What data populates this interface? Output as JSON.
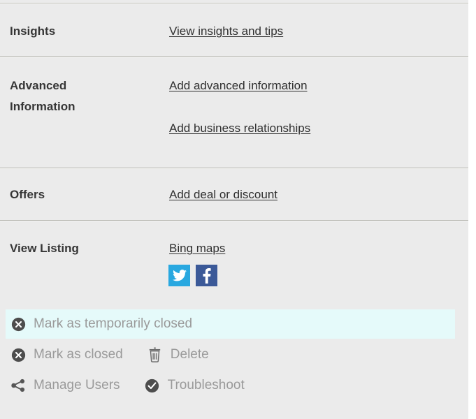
{
  "colors": {
    "panel_bg": "#ebebeb",
    "divider": "#b3b3ad",
    "label_text": "#363636",
    "link_text": "#2f2f2f",
    "action_text": "#9a9a9a",
    "highlight_bg": "#e5fafa",
    "twitter_blue": "#29a8e0",
    "facebook_blue": "#3b5998"
  },
  "sections": [
    {
      "label": "Insights",
      "label_line2": "",
      "links": [
        {
          "text": "View insights and tips",
          "name": "link-view-insights-and-tips"
        }
      ]
    },
    {
      "label": "Advanced",
      "label_line2": "Information",
      "links": [
        {
          "text": "Add advanced information",
          "name": "link-add-advanced-information"
        },
        {
          "text": "Add business relationships",
          "name": "link-add-business-relationships"
        }
      ]
    },
    {
      "label": "Offers",
      "label_line2": "",
      "links": [
        {
          "text": "Add deal or discount",
          "name": "link-add-deal-or-discount"
        }
      ]
    },
    {
      "label": "View Listing",
      "label_line2": "",
      "links": [
        {
          "text": "Bing maps",
          "name": "link-bing-maps"
        }
      ]
    }
  ],
  "social": [
    {
      "name": "twitter-icon",
      "label": "Twitter"
    },
    {
      "name": "facebook-icon",
      "label": "Facebook"
    }
  ],
  "actions": {
    "mark_temporarily_closed": {
      "label": "Mark as temporarily closed",
      "icon": "close-circle-icon",
      "highlighted": true
    },
    "mark_closed": {
      "label": "Mark as closed",
      "icon": "close-circle-icon"
    },
    "delete": {
      "label": "Delete",
      "icon": "trash-icon"
    },
    "manage_users": {
      "label": "Manage Users",
      "icon": "share-icon"
    },
    "troubleshoot": {
      "label": "Troubleshoot",
      "icon": "check-circle-icon"
    }
  }
}
